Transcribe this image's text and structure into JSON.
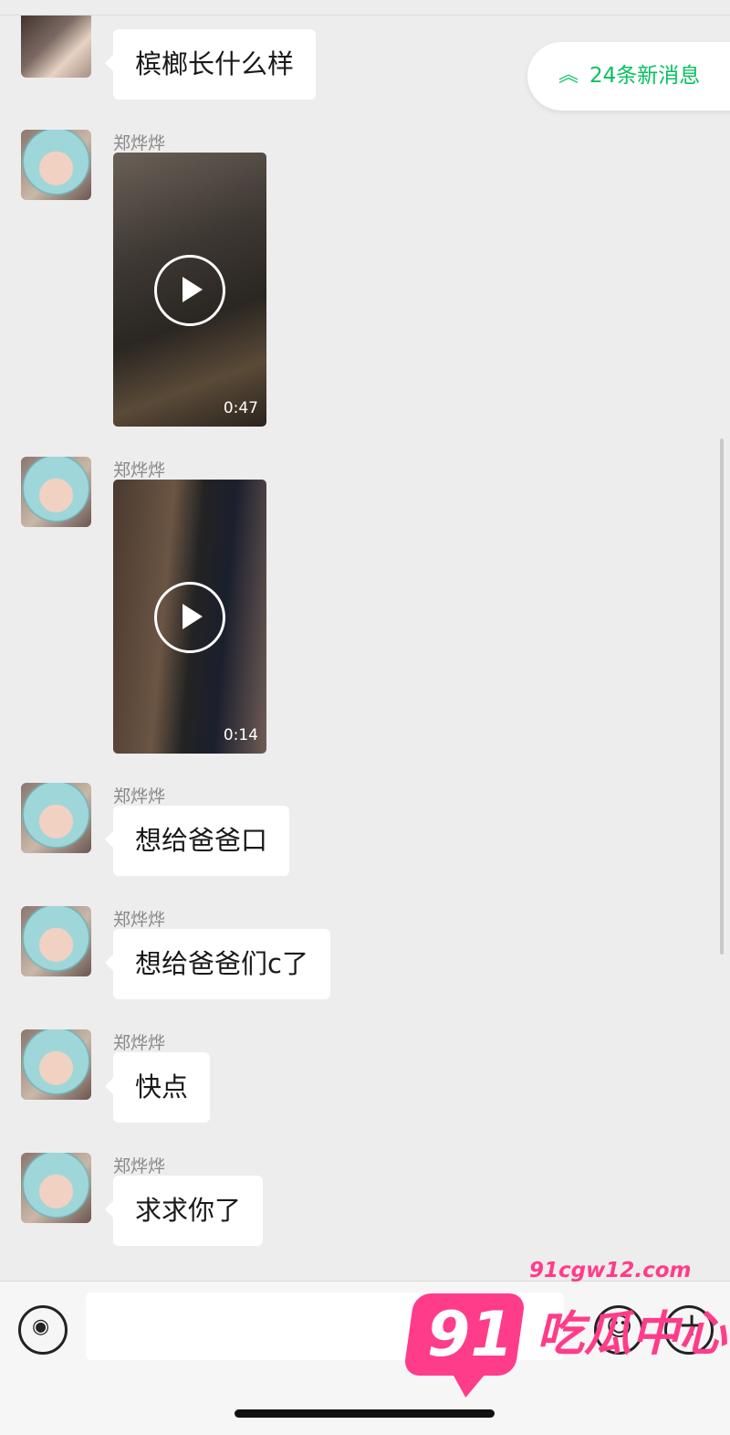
{
  "new_messages_pill": {
    "label": "24条新消息",
    "icon": "double-chevron-up-icon"
  },
  "messages": [
    {
      "sender": "",
      "type": "text",
      "text": "槟榔长什么样"
    },
    {
      "sender": "郑烨烨",
      "type": "video",
      "duration": "0:47"
    },
    {
      "sender": "郑烨烨",
      "type": "video",
      "duration": "0:14"
    },
    {
      "sender": "郑烨烨",
      "type": "text",
      "text": "想给爸爸口"
    },
    {
      "sender": "郑烨烨",
      "type": "text",
      "text": "想给爸爸们c了"
    },
    {
      "sender": "郑烨烨",
      "type": "text",
      "text": "快点"
    },
    {
      "sender": "郑烨烨",
      "type": "text",
      "text": "求求你了"
    }
  ],
  "input_bar": {
    "voice_icon": "voice-icon",
    "emoji_icon": "emoji-icon",
    "plus_icon": "plus-icon",
    "input_value": ""
  },
  "watermark": {
    "number": "91",
    "domain": "91cgw12.com",
    "name": "吃瓜中心"
  },
  "colors": {
    "accent": "#07c160",
    "background": "#ededed",
    "watermark": "#ff3c8a"
  }
}
